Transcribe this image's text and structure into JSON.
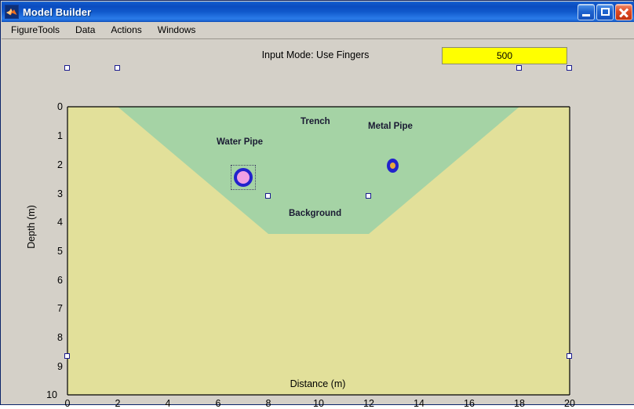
{
  "window": {
    "title": "Model Builder",
    "icon": "matlab-icon",
    "controls": {
      "minimize": "Minimize",
      "maximize": "Maximize",
      "close": "Close"
    }
  },
  "menu": {
    "items": [
      {
        "label": "FigureTools"
      },
      {
        "label": "Data"
      },
      {
        "label": "Actions"
      },
      {
        "label": "Windows"
      }
    ]
  },
  "figure": {
    "input_mode_text": "Input Mode: Use Fingers",
    "value_box": "500",
    "colors": {
      "background_region": "#e2e09a",
      "trench_region": "#a5d3a5",
      "water_pipe_fill": "#ef9fe3",
      "water_pipe_ring": "#2222cc",
      "metal_pipe_fill": "#2222cc",
      "metal_pipe_core": "#e8a83c",
      "value_box": "#ffff00",
      "handle_border": "#1b1b8f",
      "title_bar": "#0b4cc0"
    },
    "region_labels": [
      {
        "name": "trench",
        "text": "Trench"
      },
      {
        "name": "background",
        "text": "Background"
      },
      {
        "name": "water-pipe",
        "text": "Water Pipe"
      },
      {
        "name": "metal-pipe",
        "text": "Metal Pipe"
      }
    ]
  },
  "chart_data": {
    "type": "diagram",
    "title": "",
    "xlabel": "Distance (m)",
    "ylabel": "Depth (m)",
    "xlim": [
      0,
      20
    ],
    "ylim": [
      10,
      0
    ],
    "y_inverted": true,
    "xticks": [
      0,
      2,
      4,
      6,
      8,
      10,
      12,
      14,
      16,
      18,
      20
    ],
    "xticklabels": [
      "0",
      "2",
      "4",
      "6",
      "8",
      "10",
      "12",
      "14",
      "16",
      "18",
      "20"
    ],
    "yticks": [
      0,
      1,
      2,
      3,
      4,
      5,
      6,
      7,
      8,
      9,
      10
    ],
    "yticklabels": [
      "0",
      "1",
      "2",
      "3",
      "4",
      "5",
      "6",
      "7",
      "8",
      "9",
      "10"
    ],
    "grid": false,
    "shapes": [
      {
        "name": "background",
        "label": "Background",
        "fill": "#e2e09a",
        "vertices": [
          [
            0,
            0
          ],
          [
            20,
            0
          ],
          [
            20,
            10
          ],
          [
            0,
            10
          ]
        ],
        "label_pos": [
          8.6,
          4.9
        ]
      },
      {
        "name": "trench",
        "label": "Trench",
        "fill": "#a5d3a5",
        "vertices": [
          [
            2,
            0
          ],
          [
            18,
            0
          ],
          [
            12,
            4.4
          ],
          [
            8,
            4.4
          ]
        ],
        "label_pos": [
          8.65,
          1.7
        ],
        "selected": true,
        "handles": [
          [
            0,
            0
          ],
          [
            2,
            0
          ],
          [
            18,
            0
          ],
          [
            20,
            0
          ],
          [
            8,
            4.4
          ],
          [
            12,
            4.4
          ],
          [
            0,
            10
          ],
          [
            20,
            10
          ]
        ]
      },
      {
        "name": "water-pipe",
        "label": "Water Pipe",
        "fill": "#ef9fe3",
        "center": [
          6.45,
          2.55
        ],
        "radius_m": 0.33,
        "label_pos": [
          6.45,
          2.95
        ]
      },
      {
        "name": "metal-pipe",
        "label": "Metal Pipe",
        "fill": "#2222cc",
        "center": [
          12.2,
          2.1
        ],
        "radius_m": 0.2,
        "label_pos": [
          12.2,
          2.05
        ]
      }
    ]
  }
}
